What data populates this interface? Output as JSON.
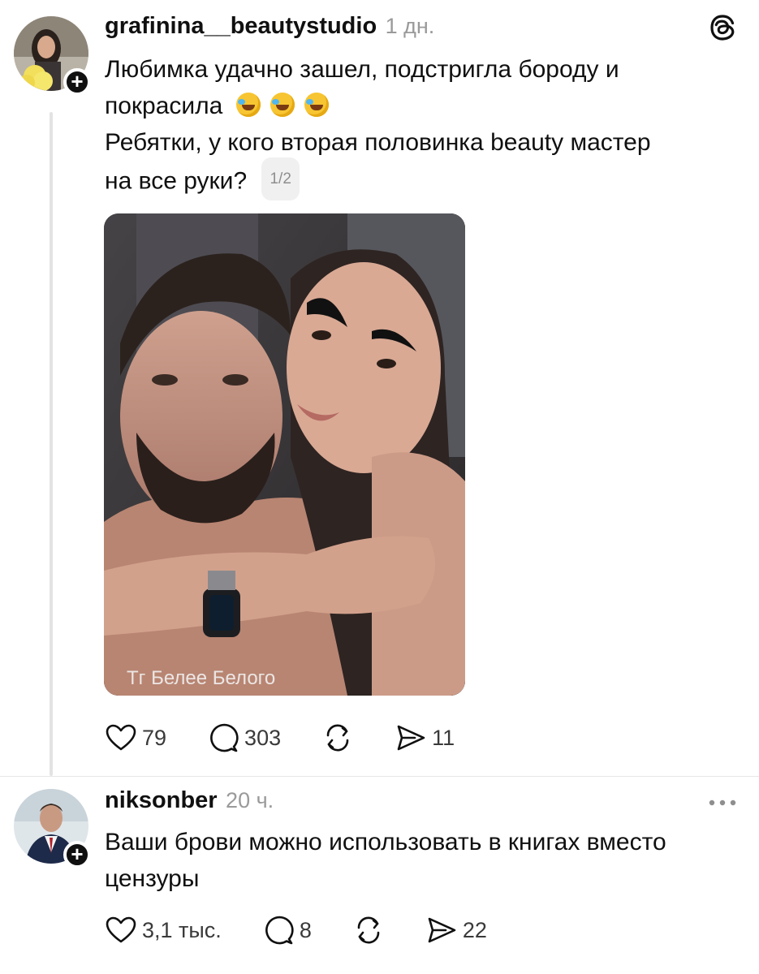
{
  "post": {
    "username": "grafinina__beautystudio",
    "time": "1 дн.",
    "line1": "Любимка удачно зашел, подстригла бороду и",
    "line2": "покрасила",
    "line3": "Ребятки,  у кого вторая половинка beauty мастер",
    "line4": "на все руки?",
    "image_counter": "1/2",
    "emojis": [
      "rolling-on-floor-laughing-emoji",
      "rolling-on-floor-laughing-emoji",
      "rolling-on-floor-laughing-emoji"
    ],
    "watermark": "Тг Белее Белого",
    "likes": "79",
    "comments": "303",
    "shares": "11"
  },
  "reply": {
    "username": "niksonber",
    "time": "20 ч.",
    "line1": "Ваши брови можно использовать в книгах вместо",
    "line2": "цензуры",
    "likes": "3,1 тыс.",
    "comments": "8",
    "shares": "22"
  },
  "icons": [
    "threads-logo-icon",
    "heart-icon",
    "comment-icon",
    "repost-icon",
    "share-icon",
    "more-icon",
    "follow-plus-icon"
  ]
}
